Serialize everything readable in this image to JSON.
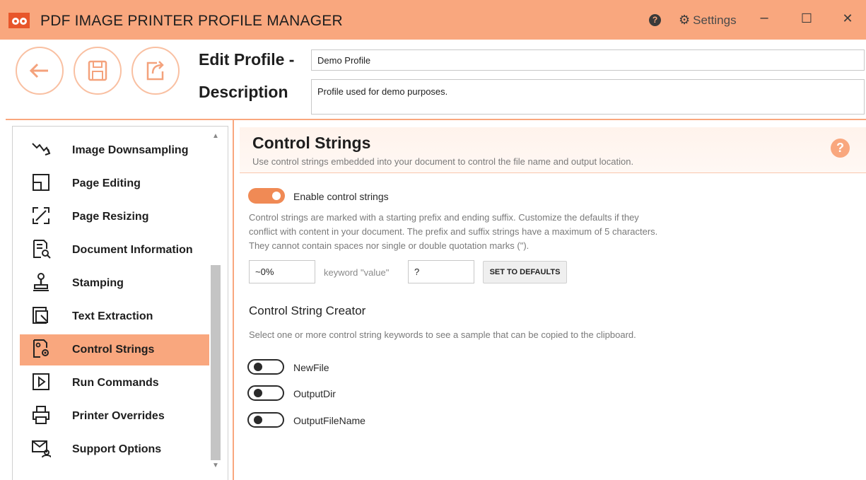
{
  "app": {
    "title": "PDF IMAGE PRINTER PROFILE MANAGER",
    "settings_label": "Settings",
    "help_glyph": "?",
    "minimize_glyph": "–",
    "maximize_glyph": "☐",
    "close_glyph": "✕"
  },
  "toolbar": {
    "back_icon": "arrow-left-icon",
    "save_icon": "save-icon",
    "export_icon": "export-icon"
  },
  "profile": {
    "edit_label": "Edit Profile -",
    "name_value": "Demo Profile",
    "description_label": "Description",
    "description_value": "Profile used for demo purposes."
  },
  "sidebar": {
    "items": [
      {
        "label": "Image Downsampling",
        "icon": "downsample-icon",
        "active": false
      },
      {
        "label": "Page Editing",
        "icon": "page-edit-icon",
        "active": false
      },
      {
        "label": "Page Resizing",
        "icon": "resize-icon",
        "active": false
      },
      {
        "label": "Document Information",
        "icon": "doc-info-icon",
        "active": false
      },
      {
        "label": "Stamping",
        "icon": "stamp-icon",
        "active": false
      },
      {
        "label": "Text Extraction",
        "icon": "text-extract-icon",
        "active": false
      },
      {
        "label": "Control Strings",
        "icon": "control-strings-icon",
        "active": true
      },
      {
        "label": "Run Commands",
        "icon": "run-icon",
        "active": false
      },
      {
        "label": "Printer Overrides",
        "icon": "printer-icon",
        "active": false
      },
      {
        "label": "Support Options",
        "icon": "support-icon",
        "active": false
      }
    ]
  },
  "section": {
    "title": "Control Strings",
    "subtitle": "Use control strings embedded into your document to control the file name and output location.",
    "help_glyph": "?"
  },
  "enable": {
    "label": "Enable control strings",
    "on": true
  },
  "description": {
    "line1": "Control strings are marked with a starting prefix and ending suffix. Customize the defaults if they",
    "line2": "conflict with content in your document. The prefix and suffix strings have a maximum of 5 characters.",
    "line3": "They cannot contain spaces nor single or double quotation marks (\")."
  },
  "prefix": {
    "value": "~0%"
  },
  "keyword_label": "keyword \"value\"",
  "suffix": {
    "value": "?"
  },
  "defaults_button": "SET TO DEFAULTS",
  "creator": {
    "title": "Control String Creator",
    "description": "Select one or more control string keywords to see a sample that can be copied to the clipboard.",
    "options": [
      {
        "label": "NewFile",
        "on": false
      },
      {
        "label": "OutputDir",
        "on": false
      },
      {
        "label": "OutputFileName",
        "on": false
      }
    ]
  },
  "colors": {
    "accent": "#f9a77e",
    "toggle_on": "#f08a55"
  }
}
